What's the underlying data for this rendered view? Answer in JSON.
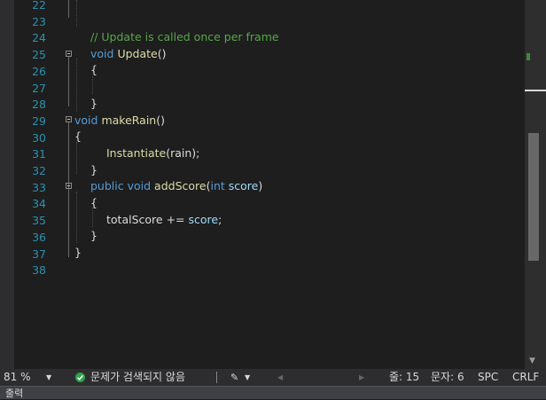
{
  "editor": {
    "line_numbers": [
      "22",
      "23",
      "24",
      "25",
      "26",
      "27",
      "28",
      "29",
      "30",
      "31",
      "32",
      "33",
      "34",
      "35",
      "36",
      "37",
      "38"
    ],
    "lines": {
      "l24_comment": "// Update is called once per frame",
      "l25_kw": "void",
      "l25_fn": "Update",
      "l25_parens": "()",
      "l26": "{",
      "l28": "}",
      "l29_kw": "void",
      "l29_fn": "makeRain",
      "l29_parens": "()",
      "l30": "{",
      "l31_fn": "Instantiate",
      "l31_rest": "(rain);",
      "l32": "}",
      "l33_kw1": "public",
      "l33_kw2": "void",
      "l33_fn": "addScore",
      "l33_open": "(",
      "l33_kw3": "int",
      "l33_param": "score",
      "l33_close": ")",
      "l34": "{",
      "l35_var": "totalScore += ",
      "l35_param": "score",
      "l35_end": ";",
      "l36": "}",
      "l37": "}"
    }
  },
  "status_bar": {
    "zoom": "81 %",
    "issues": "문제가 검색되지 않음",
    "line": "줄: 15",
    "char": "문자: 6",
    "spacing": "SPC",
    "line_ending": "CRLF"
  },
  "bottom_panel": {
    "label": "출력"
  },
  "colors": {
    "keyword": "#569cd6",
    "function": "#dcdcaa",
    "comment": "#57a64a",
    "parameter": "#9cdcfe",
    "line_number": "#2b91af"
  }
}
